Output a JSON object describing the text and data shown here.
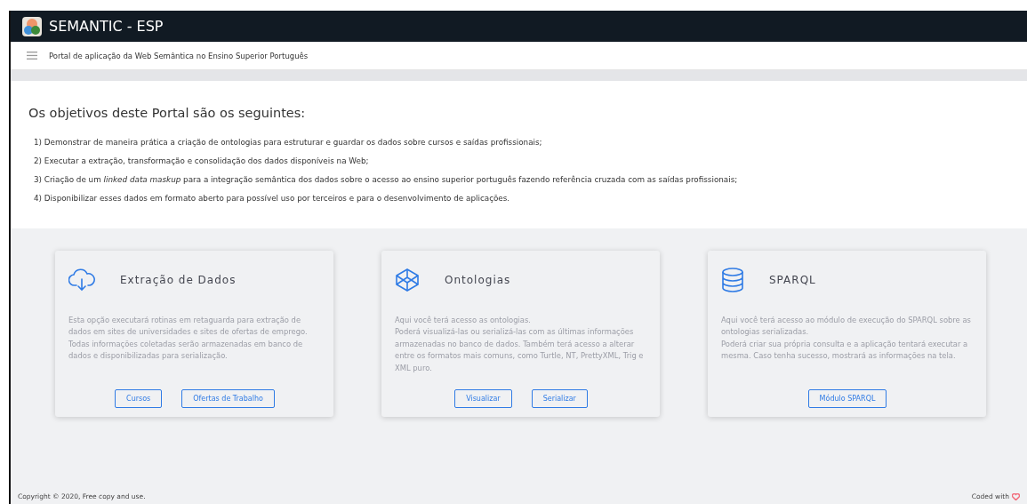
{
  "app_bar": {
    "title": "SEMANTIC - ESP"
  },
  "sub_bar": {
    "text": "Portal de aplicação da Web Semântica no Ensino Superior Português"
  },
  "intro": {
    "heading": "Os objetivos deste Portal são os seguintes:",
    "items": [
      "1) Demonstrar de maneira prática a criação de ontologias para estruturar e guardar os dados sobre cursos e saídas profissionais;",
      "2) Executar a extração, transformação e consolidação dos dados disponíveis na Web;",
      "3) Criação de um *linked data maskup* para a integração semântica dos dados sobre o acesso ao ensino superior português fazendo referência cruzada com as saídas profissionais;",
      "4) Disponibilizar esses dados em formato aberto para possível uso por terceiros e para o desenvolvimento de aplicações."
    ]
  },
  "cards": [
    {
      "kind": "cloud",
      "title": "Extração de Dados",
      "paragraphs": [
        "Esta opção executará rotinas em retaguarda para extração de dados em sites de universidades e sites de ofertas de emprego. Todas informações coletadas serão armazenadas em banco de dados e disponibilizadas para serialização."
      ],
      "buttons": [
        "Cursos",
        "Ofertas de Trabalho"
      ]
    },
    {
      "kind": "cube",
      "title": "Ontologias",
      "paragraphs": [
        "Aqui você terá acesso as ontologias.",
        "Poderá visualizá-las ou serializá-las com as últimas informações armazenadas no banco de dados. Também terá acesso a alterar entre os formatos mais comuns, como Turtle, NT, PrettyXML, Trig e XML puro."
      ],
      "buttons": [
        "Visualizar",
        "Serializar"
      ]
    },
    {
      "kind": "database",
      "title": "SPARQL",
      "paragraphs": [
        "Aqui você terá acesso ao módulo de execução do SPARQL sobre as ontologias serializadas.",
        "Poderá criar sua própria consulta e a aplicação tentará executar a mesma. Caso tenha sucesso, mostrará as informações na tela."
      ],
      "buttons": [
        "Módulo SPARQL"
      ]
    }
  ],
  "footer": {
    "copyright": "Copyright © 2020, Free copy and use.",
    "credit": "Coded with"
  }
}
